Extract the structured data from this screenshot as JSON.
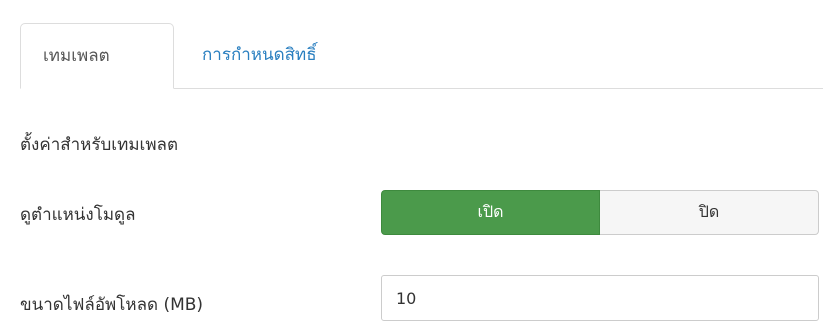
{
  "tabs": [
    {
      "label": "เทมเพลต",
      "active": true
    },
    {
      "label": "การกำหนดสิทธิ์",
      "active": false
    }
  ],
  "section": {
    "title": "ตั้งค่าสำหรับเทมเพลต"
  },
  "module_positions": {
    "label": "ดูตำแหน่งโมดูล",
    "on_label": "เปิด",
    "off_label": "ปิด",
    "selected": "เปิด"
  },
  "upload": {
    "label": "ขนาดไฟล์อัพโหลด (MB)",
    "value": "10"
  },
  "colors": {
    "accent_green": "#4b9a4b",
    "link_blue": "#2a7fc0"
  }
}
